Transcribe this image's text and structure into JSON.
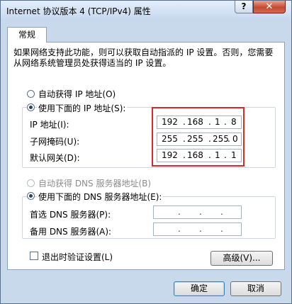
{
  "window": {
    "title": "Internet 协议版本 4 (TCP/IPv4) 属性",
    "help_label": "?",
    "close_label": "✕"
  },
  "tabs": [
    {
      "label": "常规"
    }
  ],
  "description": "如果网络支持此功能，则可以获取自动指派的 IP 设置。否则，您需要从网络系统管理员处获得适当的 IP 设置。",
  "ip": {
    "auto_label": "自动获得 IP 地址(O)",
    "manual_label": "使用下面的 IP 地址(S):",
    "selected": "manual",
    "fields": [
      {
        "label": "IP 地址(I):",
        "octets": [
          "192",
          "168",
          "1",
          "8"
        ]
      },
      {
        "label": "子网掩码(U):",
        "octets": [
          "255",
          "255",
          "255",
          "0"
        ]
      },
      {
        "label": "默认网关(D):",
        "octets": [
          "192",
          "168",
          "1",
          "1"
        ]
      }
    ]
  },
  "dns": {
    "auto_label": "自动获得 DNS 服务器地址(B)",
    "manual_label": "使用下面的 DNS 服务器地址(E):",
    "selected": "manual",
    "fields": [
      {
        "label": "首选 DNS 服务器(P):",
        "octets": [
          "",
          "",
          "",
          ""
        ]
      },
      {
        "label": "备用 DNS 服务器(A):",
        "octets": [
          "",
          "",
          "",
          ""
        ]
      }
    ]
  },
  "validate_on_exit": {
    "label": "退出时验证设置(L)",
    "checked": false
  },
  "buttons": {
    "advanced": "高级(V)...",
    "ok": "确定",
    "cancel": "取消"
  },
  "dot": "."
}
